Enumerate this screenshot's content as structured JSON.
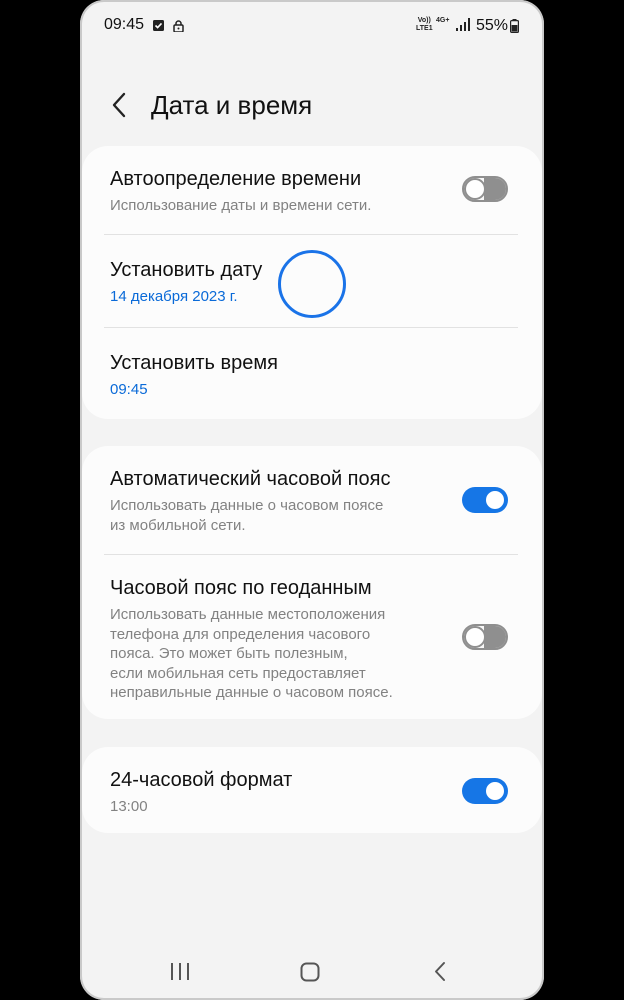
{
  "status_bar": {
    "time": "09:45",
    "volte_line1": "Vo))",
    "volte_line2": "LTE1",
    "network": "4G+",
    "battery": "55%",
    "icons": [
      "check-notification-icon",
      "lock-icon",
      "volte-icon",
      "signal-icon",
      "battery-icon"
    ]
  },
  "header": {
    "title": "Дата и время",
    "back_icon": "chevron-left-icon"
  },
  "sections": [
    {
      "items": [
        {
          "title": "Автоопределение времени",
          "subtitle": "Использование даты и времени сети.",
          "toggle": false
        },
        {
          "title": "Установить дату",
          "subtitle": "14 декабря 2023 г."
        },
        {
          "title": "Установить время",
          "subtitle": "09:45"
        }
      ]
    },
    {
      "items": [
        {
          "title": "Автоматический часовой пояс",
          "subtitle": "Использовать данные о часовом поясе\nиз мобильной сети.",
          "toggle": true
        },
        {
          "title": "Часовой пояс по геоданным",
          "subtitle": "Использовать данные местоположения\nтелефона для определения часового\nпояса. Это может быть полезным,\nесли мобильная сеть предоставляет\nнеправильные данные о часовом поясе.",
          "toggle": false
        }
      ]
    },
    {
      "items": [
        {
          "title": "24-часовой формат",
          "subtitle": "13:00",
          "toggle": true
        }
      ]
    }
  ],
  "colors": {
    "accent": "#1676e6",
    "link": "#0a6ad8",
    "background": "#f3f3f3",
    "card": "#fcfcfc"
  },
  "nav_bar": {
    "icons": [
      "recent-apps-icon",
      "home-icon",
      "back-icon"
    ]
  }
}
